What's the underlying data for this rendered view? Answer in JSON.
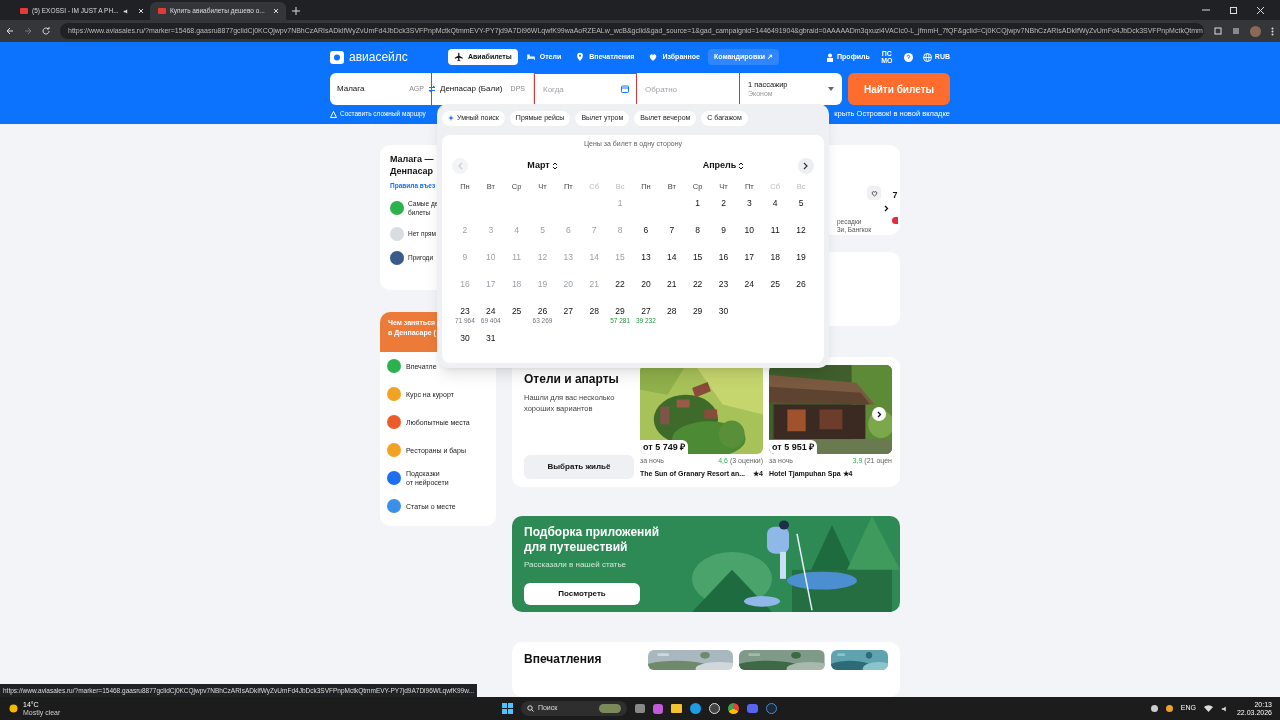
{
  "browser": {
    "tabs": [
      {
        "title": "(5) EXOSSI - IM JUST A PH...",
        "selected": false,
        "audio": true
      },
      {
        "title": "Купить авиабилеты дешево о...",
        "selected": true,
        "audio": false
      }
    ],
    "url": "https://www.aviasales.ru/?marker=15468.gaasru8877gclidCj0KCQjwpv7NBhCzARIsADkIfWyZvUmFd4JbDck3SVFPnpMctkQtmmEVY-PY7jd9A7Di96WLqwfK99waAoRZEALw_wcB&gclid&gad_source=1&gad_campaignid=1446491904&gbraid=0AAAAADm3qxuzi4VACIc0-L_jfmmH_7fQF&gclid=Cj0KCQjwpv7NBhCzARIsADkIfWyZvUmFd4JbDck3SVFPnpMctkQtmm"
  },
  "header": {
    "logo": "авиасейлс",
    "nav": [
      {
        "label": "Авиабилеты",
        "selected": true,
        "kind": "plane"
      },
      {
        "label": "Отели",
        "selected": false,
        "kind": "bed"
      },
      {
        "label": "Впечатления",
        "selected": false,
        "kind": "pin"
      },
      {
        "label": "Избранное",
        "selected": false,
        "kind": "heart"
      },
      {
        "label": "Командировки ↗",
        "selected": false,
        "kind": "external"
      }
    ],
    "profile": "Профиль",
    "badge": "ПС МО",
    "currency": "RUB"
  },
  "search": {
    "origin": {
      "value": "Малага",
      "code": "AGP"
    },
    "destination": {
      "value": "Денпасар (Бали)",
      "code": "DPS"
    },
    "depart": {
      "placeholder": "Когда",
      "focused": true
    },
    "return": {
      "placeholder": "Обратно"
    },
    "passengers": "1 пассажир",
    "cabin": "Эконом",
    "submit": "Найти билеты",
    "route_link": "Составить сложный маршру",
    "ostrovok_link": "крыть Островок! в новой вкладке"
  },
  "calendar": {
    "chips": [
      {
        "label": "Умный поиск",
        "kind": "smart"
      },
      {
        "label": "Прямые рейсы",
        "kind": "plain"
      },
      {
        "label": "Вылет утром",
        "kind": "plain"
      },
      {
        "label": "Вылет вечером",
        "kind": "plain"
      },
      {
        "label": "С багажом",
        "kind": "plain"
      }
    ],
    "note": "Цены за билет в одну сторону",
    "months": [
      {
        "name": "Март",
        "prev_disabled": true,
        "weekdays": [
          {
            "label": "Пн",
            "weekend": false
          },
          {
            "label": "Вт",
            "weekend": false
          },
          {
            "label": "Ср",
            "weekend": false
          },
          {
            "label": "Чт",
            "weekend": false
          },
          {
            "label": "Пт",
            "weekend": false
          },
          {
            "label": "Сб",
            "weekend": true
          },
          {
            "label": "Вс",
            "weekend": true
          }
        ],
        "weeks": [
          [
            {
              "kind": "blank"
            },
            {
              "kind": "blank"
            },
            {
              "kind": "blank"
            },
            {
              "kind": "blank"
            },
            {
              "kind": "blank"
            },
            {
              "kind": "blank"
            },
            {
              "kind": "day",
              "day": "1",
              "disabled": true
            }
          ],
          [
            {
              "kind": "day",
              "day": "2",
              "disabled": true
            },
            {
              "kind": "day",
              "day": "3",
              "disabled": true
            },
            {
              "kind": "day",
              "day": "4",
              "disabled": true
            },
            {
              "kind": "day",
              "day": "5",
              "disabled": true
            },
            {
              "kind": "day",
              "day": "6",
              "disabled": true
            },
            {
              "kind": "day",
              "day": "7",
              "disabled": true
            },
            {
              "kind": "day",
              "day": "8",
              "disabled": true
            }
          ],
          [
            {
              "kind": "day",
              "day": "9",
              "disabled": true
            },
            {
              "kind": "day",
              "day": "10",
              "disabled": true
            },
            {
              "kind": "day",
              "day": "11",
              "disabled": true
            },
            {
              "kind": "day",
              "day": "12",
              "disabled": true
            },
            {
              "kind": "day",
              "day": "13",
              "disabled": true
            },
            {
              "kind": "day",
              "day": "14",
              "disabled": true
            },
            {
              "kind": "day",
              "day": "15",
              "disabled": true
            }
          ],
          [
            {
              "kind": "day",
              "day": "16",
              "disabled": true
            },
            {
              "kind": "day",
              "day": "17",
              "disabled": true
            },
            {
              "kind": "day",
              "day": "18",
              "disabled": true
            },
            {
              "kind": "day",
              "day": "19",
              "disabled": true
            },
            {
              "kind": "day",
              "day": "20",
              "disabled": true
            },
            {
              "kind": "day",
              "day": "21",
              "disabled": true
            },
            {
              "kind": "day",
              "day": "22",
              "disabled": false
            }
          ],
          [
            {
              "kind": "day",
              "day": "23",
              "disabled": false,
              "price": "71 964",
              "cheap": false
            },
            {
              "kind": "day",
              "day": "24",
              "disabled": false,
              "price": "69 404",
              "cheap": false
            },
            {
              "kind": "day",
              "day": "25",
              "disabled": false
            },
            {
              "kind": "day",
              "day": "26",
              "disabled": false,
              "price": "63 269",
              "cheap": false
            },
            {
              "kind": "day",
              "day": "27",
              "disabled": false
            },
            {
              "kind": "day",
              "day": "28",
              "disabled": false
            },
            {
              "kind": "day",
              "day": "29",
              "disabled": false,
              "price": "57 281",
              "cheap": true
            }
          ],
          [
            {
              "kind": "day",
              "day": "30",
              "disabled": false
            },
            {
              "kind": "day",
              "day": "31",
              "disabled": false
            }
          ]
        ]
      },
      {
        "name": "Апрель",
        "next_disabled": false,
        "weekdays": [
          {
            "label": "Пн",
            "weekend": false
          },
          {
            "label": "Вт",
            "weekend": false
          },
          {
            "label": "Ср",
            "weekend": false
          },
          {
            "label": "Чт",
            "weekend": false
          },
          {
            "label": "Пт",
            "weekend": false
          },
          {
            "label": "Сб",
            "weekend": true
          },
          {
            "label": "Вс",
            "weekend": true
          }
        ],
        "weeks": [
          [
            {
              "kind": "blank"
            },
            {
              "kind": "blank"
            },
            {
              "kind": "day",
              "day": "1",
              "disabled": false
            },
            {
              "kind": "day",
              "day": "2",
              "disabled": false
            },
            {
              "kind": "day",
              "day": "3",
              "disabled": false
            },
            {
              "kind": "day",
              "day": "4",
              "disabled": false
            },
            {
              "kind": "day",
              "day": "5",
              "disabled": false
            }
          ],
          [
            {
              "kind": "day",
              "day": "6",
              "disabled": false
            },
            {
              "kind": "day",
              "day": "7",
              "disabled": false
            },
            {
              "kind": "day",
              "day": "8",
              "disabled": false
            },
            {
              "kind": "day",
              "day": "9",
              "disabled": false
            },
            {
              "kind": "day",
              "day": "10",
              "disabled": false
            },
            {
              "kind": "day",
              "day": "11",
              "disabled": false
            },
            {
              "kind": "day",
              "day": "12",
              "disabled": false
            }
          ],
          [
            {
              "kind": "day",
              "day": "13",
              "disabled": false
            },
            {
              "kind": "day",
              "day": "14",
              "disabled": false
            },
            {
              "kind": "day",
              "day": "15",
              "disabled": false
            },
            {
              "kind": "day",
              "day": "16",
              "disabled": false
            },
            {
              "kind": "day",
              "day": "17",
              "disabled": false
            },
            {
              "kind": "day",
              "day": "18",
              "disabled": false
            },
            {
              "kind": "day",
              "day": "19",
              "disabled": false
            }
          ],
          [
            {
              "kind": "day",
              "day": "20",
              "disabled": false
            },
            {
              "kind": "day",
              "day": "21",
              "disabled": false
            },
            {
              "kind": "day",
              "day": "22",
              "disabled": false
            },
            {
              "kind": "day",
              "day": "23",
              "disabled": false
            },
            {
              "kind": "day",
              "day": "24",
              "disabled": false
            },
            {
              "kind": "day",
              "day": "25",
              "disabled": false
            },
            {
              "kind": "day",
              "day": "26",
              "disabled": false
            }
          ],
          [
            {
              "kind": "day",
              "day": "27",
              "disabled": false,
              "price": "39 232",
              "cheap": true
            },
            {
              "kind": "day",
              "day": "28",
              "disabled": false
            },
            {
              "kind": "day",
              "day": "29",
              "disabled": false
            },
            {
              "kind": "day",
              "day": "30",
              "disabled": false
            }
          ]
        ]
      }
    ]
  },
  "route_card": {
    "title": [
      "Малага —",
      "Денпасар"
    ],
    "rules_link": "Правила въез",
    "items": [
      {
        "label": "Самые де\nбилеты",
        "color": "#2bb24c"
      },
      {
        "label": "Нет прям",
        "color": "#d9dce1"
      },
      {
        "label": "Пригоди",
        "color": "#3b5a8c"
      }
    ]
  },
  "activities": {
    "title": [
      "Чем заняться",
      "в Денпасаре ("
    ],
    "items": [
      {
        "label": "Впечатле",
        "color": "#2bb24c"
      },
      {
        "label": "Курс на курорт",
        "color": "#f2a322"
      },
      {
        "label": "Любопытные места",
        "color": "#ec5b2b"
      },
      {
        "label": "Рестораны и бары",
        "color": "#f2a322"
      },
      {
        "label": "Подсказки\nот нейросети",
        "color": "#1e6ef0"
      },
      {
        "label": "Статьи о месте",
        "color": "#3a8fe8"
      }
    ]
  },
  "offers_card": {
    "fragments": [
      "ресадки",
      "3и, Бангкок"
    ],
    "side_text": "7"
  },
  "hotels": {
    "title": "Отели и апарты",
    "subtitle": "Нашли для вас несколько хороших вариантов",
    "button": "Выбрать жильё",
    "items": [
      {
        "price": "от 5 749 ₽",
        "per": "за ночь",
        "rating": "4,6",
        "reviews": "(3 оценки)",
        "name": "The Sun of Granary Resort an...",
        "stars": "★4",
        "kind": "fields"
      },
      {
        "price": "от 5 951 ₽",
        "per": "за ночь",
        "rating": "3,9",
        "reviews": "(21 оцен",
        "name": "Hotel Tjampuhan Spa ★4",
        "kind": "pavilion"
      }
    ]
  },
  "promo": {
    "title": "Подборка приложений для путешествий",
    "subtitle": "Рассказали в нашей статье",
    "button": "Посмотреть"
  },
  "experiences": {
    "title": "Впечатления"
  },
  "status_url": "https://www.aviasales.ru/?marker=15468.gaasru8877gclidCj0KCQjwpv7NBhCzARIsADkIfWyZvUmFd4JbDck3SVFPnpMctkQtmmEVY-PY7jd9A7Di96WLqwfK99w...",
  "taskbar": {
    "temperature": "14°C",
    "weather": "Mostly clear",
    "search": "Поиск",
    "language": "ENG",
    "time": "20:13",
    "date": "22.03.2026"
  }
}
